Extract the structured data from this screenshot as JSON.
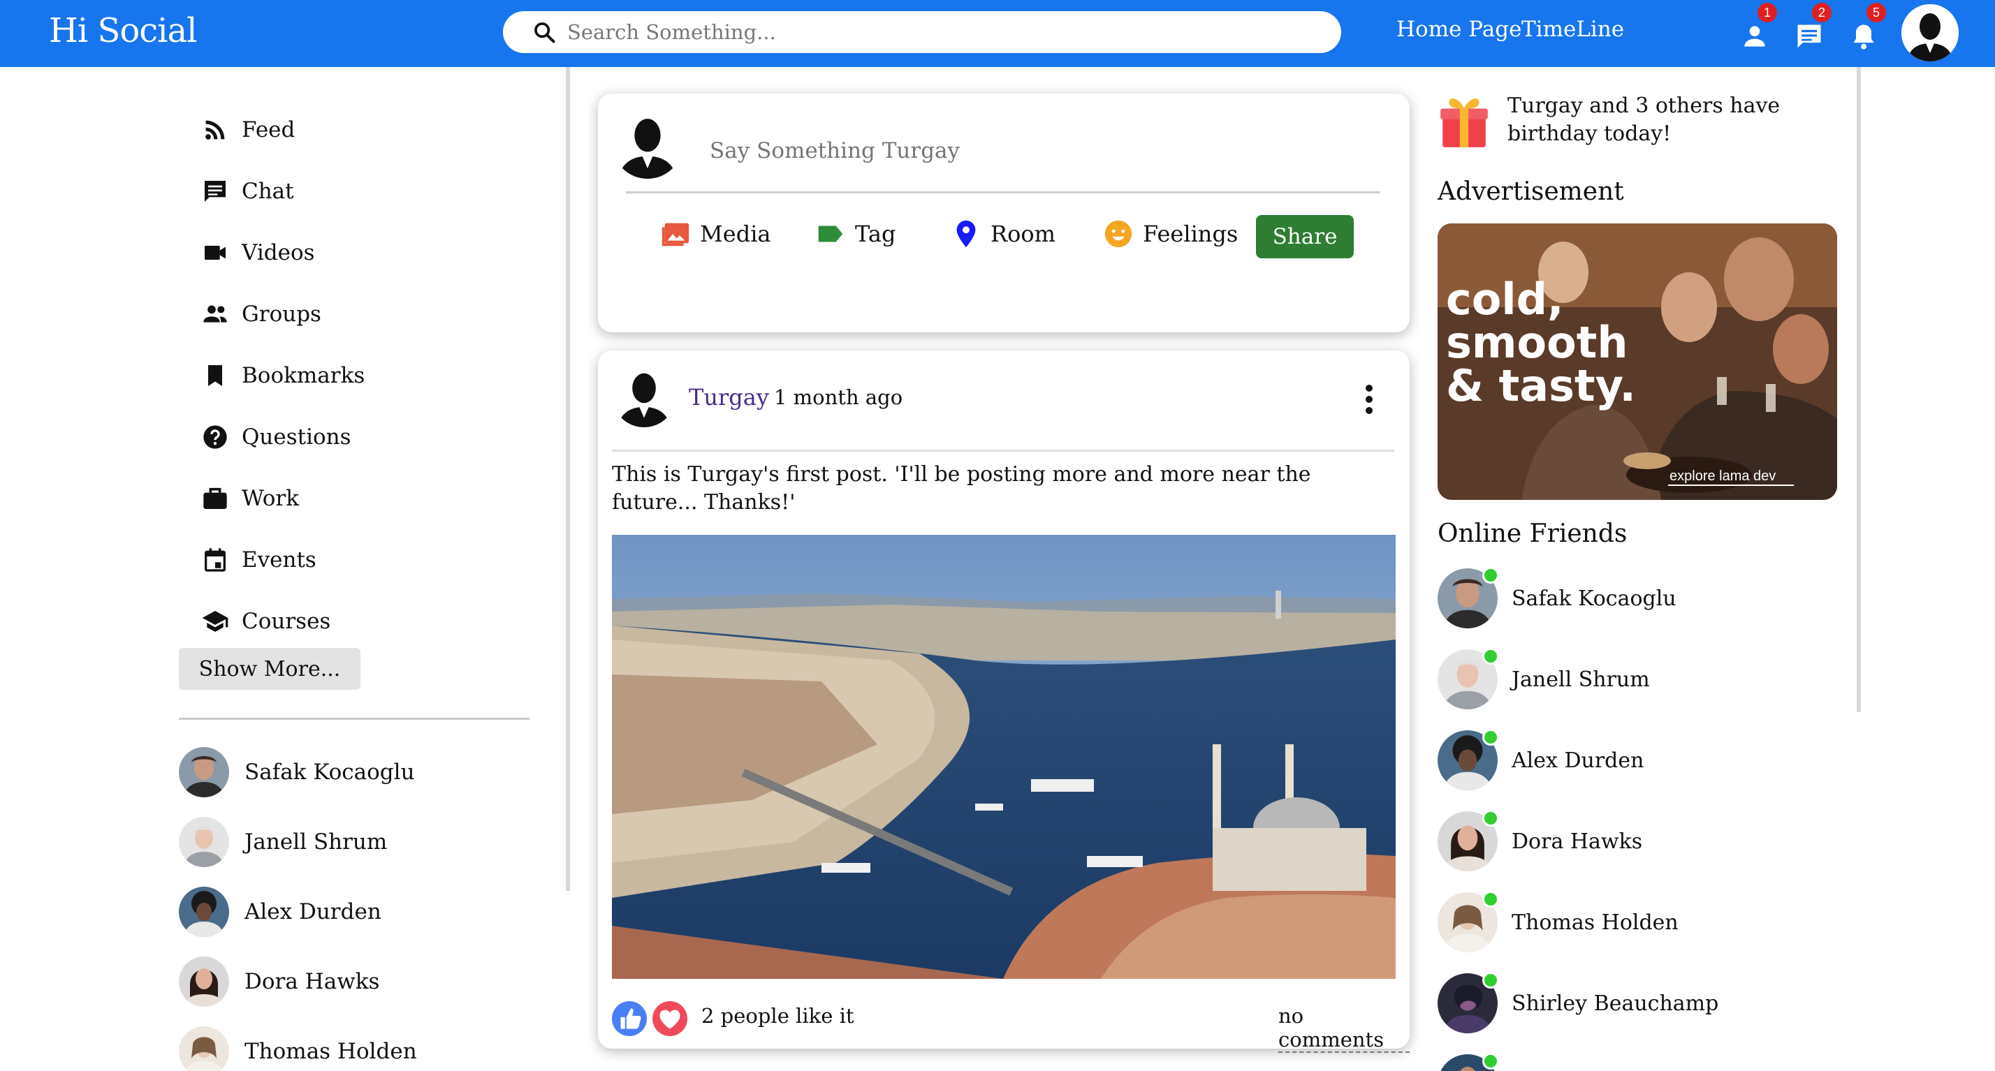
{
  "app": {
    "logo": "Hi Social"
  },
  "search": {
    "placeholder": "Search Something..."
  },
  "topnav": {
    "links": [
      "Home Page",
      "TimeLine"
    ]
  },
  "notifications": {
    "friends": {
      "icon": "person-icon",
      "count": "1"
    },
    "messages": {
      "icon": "chat-icon",
      "count": "2"
    },
    "alerts": {
      "icon": "bell-icon",
      "count": "5"
    }
  },
  "sidebar": {
    "items": [
      {
        "label": "Feed",
        "icon": "rss-icon"
      },
      {
        "label": "Chat",
        "icon": "chat-icon"
      },
      {
        "label": "Videos",
        "icon": "video-icon"
      },
      {
        "label": "Groups",
        "icon": "group-icon"
      },
      {
        "label": "Bookmarks",
        "icon": "bookmark-icon"
      },
      {
        "label": "Questions",
        "icon": "help-icon"
      },
      {
        "label": "Work",
        "icon": "briefcase-icon"
      },
      {
        "label": "Events",
        "icon": "calendar-icon"
      },
      {
        "label": "Courses",
        "icon": "school-icon"
      }
    ],
    "show_more": "Show More...",
    "friends": [
      "Safak Kocaoglu",
      "Janell Shrum",
      "Alex Durden",
      "Dora Hawks",
      "Thomas Holden"
    ]
  },
  "share": {
    "placeholder": "Say Something Turgay",
    "options": [
      {
        "label": "Media",
        "icon": "photo-icon",
        "color": "#e8573f"
      },
      {
        "label": "Tag",
        "icon": "label-icon",
        "color": "#2e8b3a"
      },
      {
        "label": "Room",
        "icon": "location-icon",
        "color": "#1a1aff"
      },
      {
        "label": "Feelings",
        "icon": "emoji-icon",
        "color": "#f5a623"
      }
    ],
    "button": "Share"
  },
  "post": {
    "username": "Turgay",
    "date": "1 month ago",
    "text": "This is Turgay's first post. 'I'll be posting more and more near the future... Thanks!'",
    "likes": "2 people like it",
    "comments": "no comments"
  },
  "rightbar": {
    "birthday": "Turgay and 3 others have birthday today!",
    "ad_title": "Advertisement",
    "ad_text": "cold, smooth & tasty.",
    "ad_caption": "explore lama dev",
    "online_title": "Online Friends",
    "online": [
      "Safak Kocaoglu",
      "Janell Shrum",
      "Alex Durden",
      "Dora Hawks",
      "Thomas Holden",
      "Shirley Beauchamp"
    ]
  },
  "colors": {
    "brand": "#1775ee",
    "share": "#2e7d32",
    "online": "#32cd32",
    "badge": "#e02020"
  }
}
